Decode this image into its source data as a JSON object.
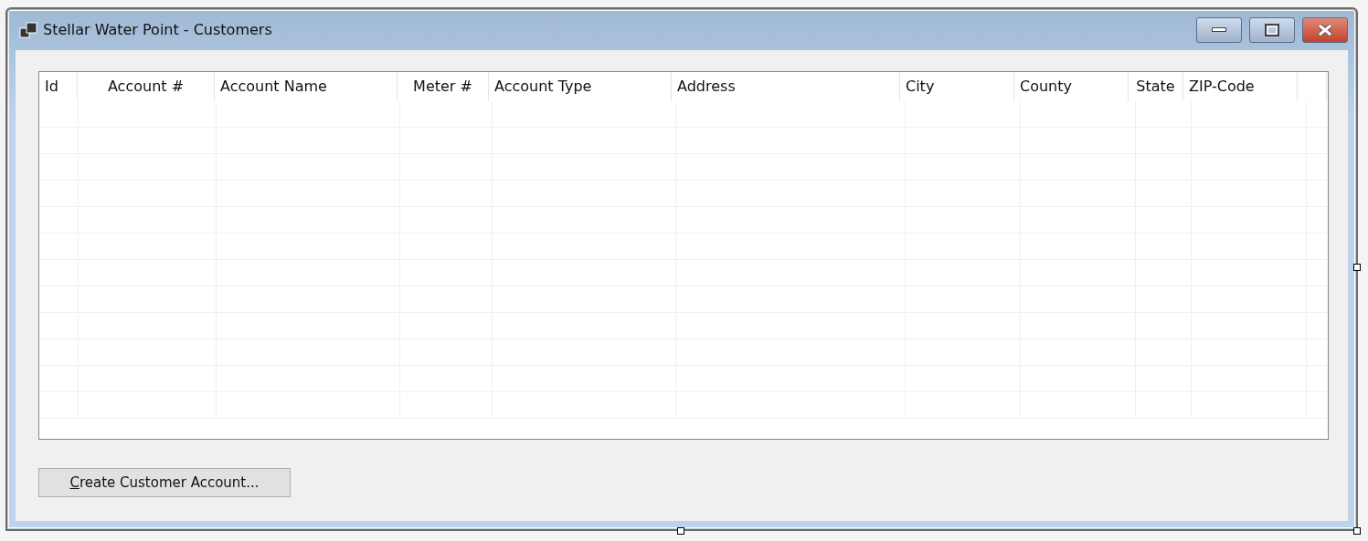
{
  "window": {
    "title": "Stellar Water Point - Customers"
  },
  "table": {
    "columns": [
      {
        "label": "Id"
      },
      {
        "label": "Account #"
      },
      {
        "label": "Account Name"
      },
      {
        "label": "Meter #"
      },
      {
        "label": "Account Type"
      },
      {
        "label": "Address"
      },
      {
        "label": "City"
      },
      {
        "label": "County"
      },
      {
        "label": "State"
      },
      {
        "label": "ZIP-Code"
      }
    ]
  },
  "buttons": [
    {
      "label": "Create Customer Account...",
      "mnemonic_underlined": true
    }
  ]
}
